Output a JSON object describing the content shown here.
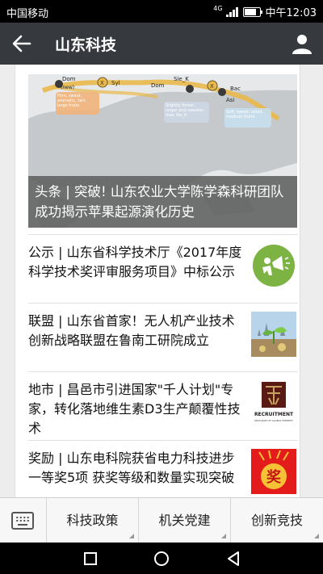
{
  "status_bar": {
    "carrier": "中国移动",
    "network": "4G",
    "time": "中午12:03"
  },
  "app_bar": {
    "title": "山东科技"
  },
  "hero": {
    "map_labels": [
      "Dom",
      "(new)",
      "Syl",
      "Sie_K",
      "Bac",
      "Asi"
    ],
    "annotations": [
      "Firm, sweet, aromatic, tart, large fruits",
      "Slightly firmer, larger and sweeter than Sie_K",
      "Soft, sweet, small, medium fruits"
    ],
    "caption": "头条 | 突破! 山东农业大学陈学森科研团队成功揭示苹果起源演化历史"
  },
  "news": [
    {
      "title": "公示 | 山东省科学技术厅《2017年度科学技术奖评审服务项目》中标公示",
      "thumb": "megaphone-icon"
    },
    {
      "title": "联盟 | 山东省首家！无人机产业技术创新战略联盟在鲁南工研院成立",
      "thumb": "sprout-image"
    },
    {
      "title": "地市 | 昌邑市引进国家\"千人计划\"专家，转化落地维生素D3生产颠覆性技术",
      "thumb": "recruitment-logo",
      "thumb_text": [
        "RECRUITMENT",
        "PROGRAM OF GLOBAL EXPERTS"
      ]
    },
    {
      "title": "奖励 | 山东电科院获省电力科技进步一等奖5项 获奖等级和数量实现突破",
      "thumb": "award-image",
      "thumb_text": "奖"
    }
  ],
  "bottom_menu": {
    "items": [
      "科技政策",
      "机关党建",
      "创新竞技"
    ]
  },
  "colors": {
    "app_bar": "#36393e",
    "megaphone_green": "#7cb342",
    "award_red": "#e31b1b"
  }
}
